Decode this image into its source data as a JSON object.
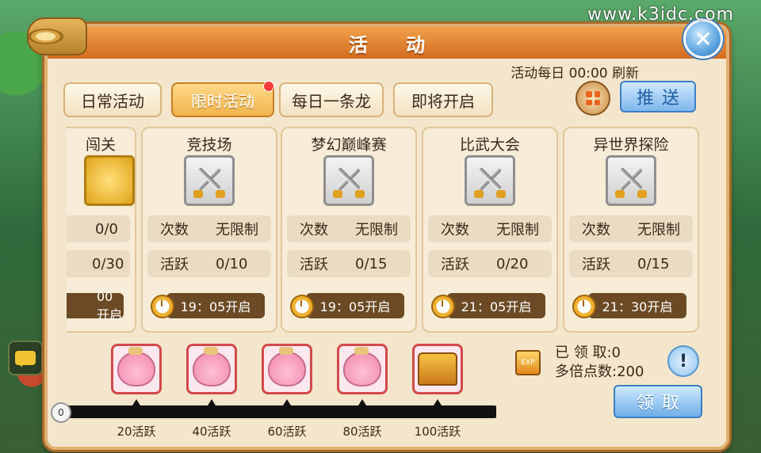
{
  "watermark": "www.k3idc.com",
  "title": "活 动",
  "refresh_note": "活动每日 00:00 刷新",
  "tabs": [
    {
      "label": "日常活动",
      "active": false
    },
    {
      "label": "限时活动",
      "active": true,
      "has_dot": true
    },
    {
      "label": "每日一条龙",
      "active": false
    },
    {
      "label": "即将开启",
      "active": false
    }
  ],
  "push_label": "推送",
  "cards": [
    {
      "title": "闯关",
      "row1_label": "",
      "row1_value": "0/0",
      "row2_label": "",
      "row2_value": "0/30",
      "open": "00开启",
      "icon": "gold-coin-icon"
    },
    {
      "title": "竞技场",
      "row1_label": "次数",
      "row1_value": "无限制",
      "row2_label": "活跃",
      "row2_value": "0/10",
      "open": "19：05开启",
      "icon": "crossed-swords-icon"
    },
    {
      "title": "梦幻巅峰赛",
      "row1_label": "次数",
      "row1_value": "无限制",
      "row2_label": "活跃",
      "row2_value": "0/15",
      "open": "19：05开启",
      "icon": "crossed-swords-icon"
    },
    {
      "title": "比武大会",
      "row1_label": "次数",
      "row1_value": "无限制",
      "row2_label": "活跃",
      "row2_value": "0/20",
      "open": "21：05开启",
      "icon": "crossed-swords-icon"
    },
    {
      "title": "异世界探险",
      "row1_label": "次数",
      "row1_value": "无限制",
      "row2_label": "活跃",
      "row2_value": "0/15",
      "open": "21：30开启",
      "icon": "crossed-swords-icon"
    }
  ],
  "milestones": [
    {
      "label": "20活跃",
      "reward": "lucky-bag-icon"
    },
    {
      "label": "40活跃",
      "reward": "lucky-bag-icon"
    },
    {
      "label": "60活跃",
      "reward": "lucky-bag-icon"
    },
    {
      "label": "80活跃",
      "reward": "lucky-bag-icon"
    },
    {
      "label": "100活跃",
      "reward": "treasure-chest-icon"
    }
  ],
  "progress_start": "0",
  "claim": {
    "claimed_text": "已 领 取:0",
    "multiplier_text": "多倍点数:200",
    "button_label": "领取"
  }
}
